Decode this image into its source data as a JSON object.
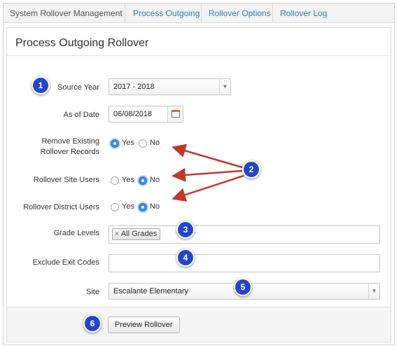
{
  "tabs": {
    "brand": "System Rollover Management",
    "process_outgoing": "Process Outgoing",
    "rollover_options": "Rollover Options",
    "rollover_log": "Rollover Log"
  },
  "page_title": "Process Outgoing Rollover",
  "form": {
    "source_year": {
      "label": "Source Year",
      "value": "2017 - 2018"
    },
    "as_of_date": {
      "label": "As of Date",
      "value": "06/08/2018"
    },
    "remove_existing": {
      "label_line1": "Remove Existing",
      "label_line2": "Rollover Records",
      "yes": "Yes",
      "no": "No",
      "selected": "Yes"
    },
    "rollover_site_users": {
      "label": "Rollover Site Users",
      "yes": "Yes",
      "no": "No",
      "selected": "No"
    },
    "rollover_district_users": {
      "label": "Rollover District Users",
      "yes": "Yes",
      "no": "No",
      "selected": "No"
    },
    "grade_levels": {
      "label": "Grade Levels",
      "chip": "All Grades",
      "chip_remove": "×"
    },
    "exclude_exit_codes": {
      "label": "Exclude Exit Codes",
      "value": ""
    },
    "site": {
      "label": "Site",
      "value": "Escalante Elementary"
    }
  },
  "buttons": {
    "preview_rollover": "Preview Rollover"
  },
  "callouts": [
    "1",
    "2",
    "3",
    "4",
    "5",
    "6"
  ],
  "colors": {
    "link": "#2a7fc1",
    "badge": "#2447c9",
    "arrow": "#c0392b",
    "radio_selected": "#3b8ee3"
  }
}
